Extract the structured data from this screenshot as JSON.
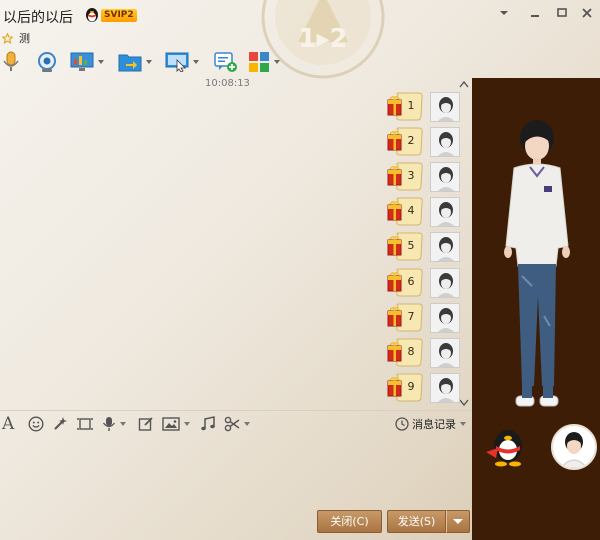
{
  "window": {
    "contact_name": "以后的以后",
    "vip_badge": "SVIP2",
    "signature": "测",
    "emblem_text": "1▸2"
  },
  "toolbar": {
    "items": [
      "voice-call",
      "video-call",
      "remote-desktop",
      "send-file",
      "screen-share",
      "create-group",
      "apps"
    ]
  },
  "chat": {
    "timestamp": "10:08:13",
    "messages": [
      {
        "number": "1"
      },
      {
        "number": "2"
      },
      {
        "number": "3"
      },
      {
        "number": "4"
      },
      {
        "number": "5"
      },
      {
        "number": "6"
      },
      {
        "number": "7"
      },
      {
        "number": "8"
      },
      {
        "number": "9"
      }
    ]
  },
  "input_toolbar": {
    "font_label": "A",
    "history_label": "消息记录"
  },
  "buttons": {
    "close_label": "关闭(C)",
    "send_label": "发送(S)"
  },
  "colors": {
    "panel_bg": "#3d1d06",
    "button_bg": "#b5814f",
    "bubble_fill": "#f6e7b3",
    "gift_red": "#d42a1a"
  }
}
